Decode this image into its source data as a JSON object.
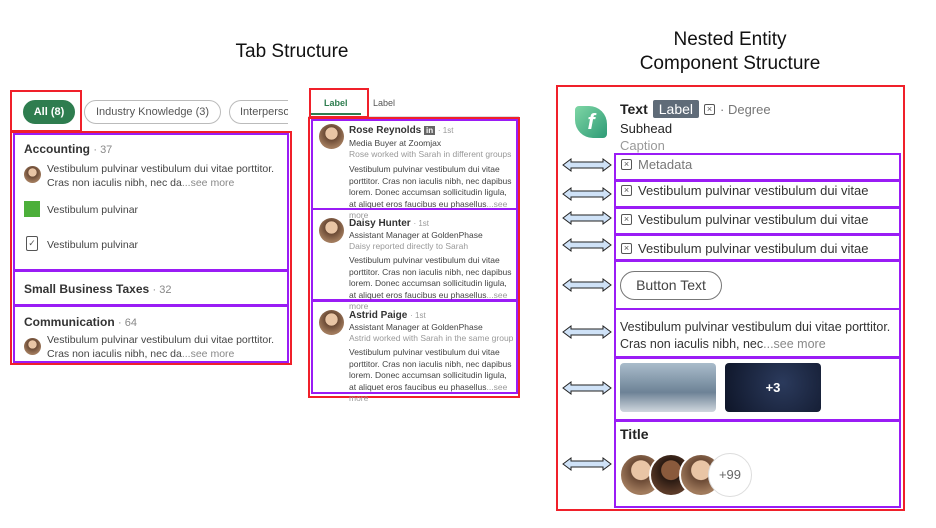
{
  "left": {
    "title": "Tab Structure",
    "tabs": [
      {
        "label": "All (8)",
        "active": true
      },
      {
        "label": "Industry Knowledge (3)"
      },
      {
        "label": "Interperso"
      }
    ],
    "sections": [
      {
        "name": "Accounting",
        "count": "· 37",
        "items": [
          {
            "icon": "avatar",
            "text": "Vestibulum pulvinar vestibulum dui vitae porttitor. Cras non iaculis nibh, nec da",
            "more": "...see more"
          },
          {
            "icon": "company-logo",
            "text": "Vestibulum pulvinar"
          },
          {
            "icon": "clipboard-check-icon",
            "text": "Vestibulum pulvinar"
          }
        ]
      },
      {
        "name": "Small Business Taxes",
        "count": "· 32",
        "items": []
      },
      {
        "name": "Communication",
        "count": "· 64",
        "items": [
          {
            "icon": "avatar",
            "text": "Vestibulum pulvinar vestibulum dui vitae porttitor. Cras non iaculis nibh, nec da",
            "more": "...see more"
          }
        ]
      }
    ]
  },
  "middle": {
    "tabs": [
      {
        "label": "Label",
        "active": true
      },
      {
        "label": "Label"
      }
    ],
    "people": [
      {
        "name": "Rose Reynolds",
        "badge": "in",
        "degree": "· 1st",
        "headline": "Media Buyer at Zoomjax",
        "relation": "Rose worked with Sarah in different groups",
        "body": "Vestibulum pulvinar vestibulum dui vitae porttitor. Cras non iaculis nibh, nec dapibus lorem. Donec accumsan sollicitudin ligula, at aliquet eros faucibus eu phasellus",
        "more": "...see more"
      },
      {
        "name": "Daisy Hunter",
        "degree": "· 1st",
        "headline": "Assistant Manager at GoldenPhase",
        "relation": "Daisy reported directly to Sarah",
        "body": "Vestibulum pulvinar vestibulum dui vitae porttitor. Cras non iaculis nibh, nec dapibus lorem. Donec accumsan sollicitudin ligula, at aliquet eros faucibus eu phasellus",
        "more": "...see more"
      },
      {
        "name": "Astrid Paige",
        "degree": "· 1st",
        "headline": "Assistant Manager at GoldenPhase",
        "relation": "Astrid worked with Sarah in the same group",
        "body": "Vestibulum pulvinar vestibulum dui vitae porttitor. Cras non iaculis nibh, nec dapibus lorem. Donec accumsan sollicitudin ligula, at aliquet eros faucibus eu phasellus",
        "more": "...see more"
      }
    ]
  },
  "right": {
    "title_line1": "Nested Entity",
    "title_line2": "Component Structure",
    "entity": {
      "text": "Text",
      "label": "Label",
      "degree": "· Degree",
      "subhead": "Subhead",
      "caption": "Caption"
    },
    "metadata": "Metadata",
    "lines": [
      "Vestibulum pulvinar vestibulum dui vitae",
      "Vestibulum pulvinar vestibulum dui vitae",
      "Vestibulum pulvinar vestibulum dui vitae"
    ],
    "button": "Button Text",
    "body": "Vestibulum pulvinar vestibulum dui vitae porttitor. Cras non iaculis nibh, nec",
    "more": "...see more",
    "media_more": "+3",
    "group_title": "Title",
    "facepile_more": "+99"
  },
  "colors": {
    "highlight_outer": "#f0202a",
    "highlight_inner": "#9a1cf5",
    "accent": "#2e7d4f",
    "label_badge": "#5f6b78"
  }
}
